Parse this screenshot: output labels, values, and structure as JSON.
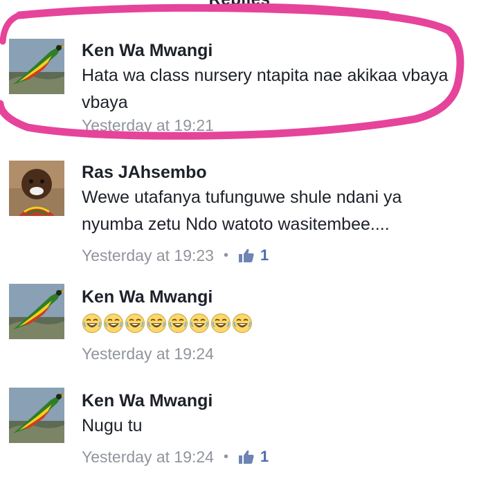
{
  "header": {
    "title": "Replies"
  },
  "comments": [
    {
      "author": "Ken Wa Mwangi",
      "text": "Hata wa class nursery ntapita nae akikaa vbaya vbaya",
      "timestamp": "Yesterday at 19:21",
      "avatar": "bird-avatar"
    },
    {
      "author": "Ras JAhsembo",
      "text": "Wewe utafanya tufunguwe shule ndani ya nyumba zetu Ndo watoto wasitembee....",
      "timestamp": "Yesterday at 19:23",
      "likes": "1",
      "avatar": "child-avatar"
    },
    {
      "author": "Ken Wa Mwangi",
      "text": "",
      "emoji": [
        "laughing-emoji",
        "laughing-emoji",
        "laughing-emoji",
        "laughing-emoji",
        "laughing-emoji",
        "laughing-emoji",
        "laughing-emoji",
        "laughing-emoji"
      ],
      "timestamp": "Yesterday at 19:24",
      "avatar": "bird-avatar"
    },
    {
      "author": "Ken Wa Mwangi",
      "text": "Nugu tu",
      "timestamp": "Yesterday at 19:24",
      "likes": "1",
      "avatar": "bird-avatar"
    }
  ],
  "colors": {
    "highlight": "#e6449b",
    "text": "#1d2129",
    "meta": "#90949c",
    "like": "#4b6cb0"
  }
}
